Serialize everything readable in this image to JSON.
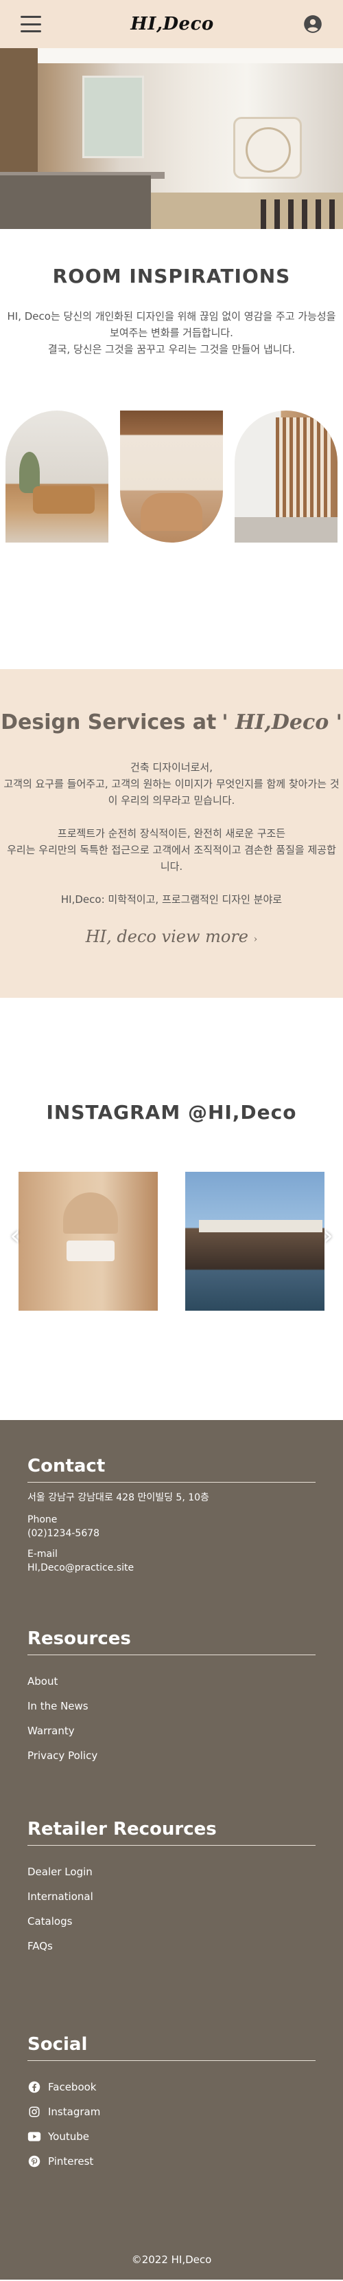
{
  "header": {
    "logo": "HI,Deco"
  },
  "hero": {
    "alt": "interior"
  },
  "rooms": {
    "title": "ROOM INSPIRATIONS",
    "desc_line1": "HI, Deco는 당신의 개인화된 디자인을 위해 끊임 없이 영감을 주고 가능성을 보여주는 변화를 거듭합니다.",
    "desc_line2": "결국, 당신은 그것을 꿈꾸고 우리는 그것을 만들어 냅니다."
  },
  "services": {
    "title": "Design Services at",
    "brand": "' HI,Deco '",
    "p1_line1": "건축 디자이너로서,",
    "p1_line2": "고객의 요구를 들어주고, 고객의 원하는 이미지가 무엇인지를 함께 찾아가는 것이 우리의 의무라고 믿습니다.",
    "p2_line1": "프로젝트가 순전히 장식적이든, 완전히 새로운 구조든",
    "p2_line2": "우리는 우리만의 독특한 접근으로 고객에서 조직적이고 겸손한 품질을 제공합니다.",
    "p3": "HI,Deco: 미학적이고, 프로그램적인 디자인 분야로",
    "more": "HI, deco view more",
    "more_arrow": "›"
  },
  "instagram": {
    "title": "INSTAGRAM @HI,Deco",
    "prev": "‹",
    "next": "›"
  },
  "footer": {
    "contact": {
      "title": "Contact",
      "address": "서울 강남구 강남대로 428 만이빌딩 5, 10층",
      "phone_label": "Phone",
      "phone": "(02)1234-5678",
      "email_label": "E-mail",
      "email": "HI,Deco@practice.site"
    },
    "resources": {
      "title": "Resources",
      "items": [
        "About",
        "In the News",
        "Warranty",
        "Privacy Policy"
      ]
    },
    "retailer": {
      "title": "Retailer Recources",
      "items": [
        "Dealer Login",
        "International",
        "Catalogs",
        "FAQs"
      ]
    },
    "social": {
      "title": "Social",
      "items": [
        "Facebook",
        "Instagram",
        "Youtube",
        "Pinterest"
      ]
    },
    "copyright": "©2022 HI,Deco"
  }
}
